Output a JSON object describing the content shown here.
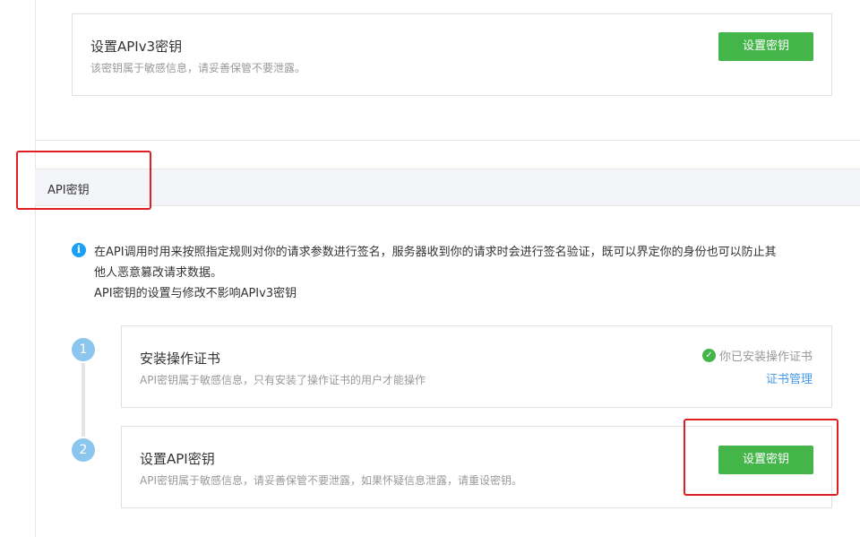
{
  "top_card": {
    "title": "设置APIv3密钥",
    "desc": "该密钥属于敏感信息，请妥善保管不要泄露。",
    "button_label": "设置密钥"
  },
  "section": {
    "header": "API密钥"
  },
  "info": {
    "icon": "info-icon",
    "icon_glyph": "i",
    "line1": "在API调用时用来按照指定规则对你的请求参数进行签名，服务器收到你的请求时会进行签名验证，既可以界定你的身份也可以防止其",
    "line2": "他人恶意篡改请求数据。",
    "line3": "API密钥的设置与修改不影响APIv3密钥"
  },
  "steps": [
    {
      "number": "1",
      "title": "安装操作证书",
      "desc": "API密钥属于敏感信息，只有安装了操作证书的用户才能操作",
      "status_text": "你已安装操作证书",
      "status_icon": "check-circle-icon",
      "status_glyph": "✓",
      "link_label": "证书管理"
    },
    {
      "number": "2",
      "title": "设置API密钥",
      "desc": "API密钥属于敏感信息，请妥善保管不要泄露，如果怀疑信息泄露，请重设密钥。",
      "button_label": "设置密钥"
    }
  ],
  "colors": {
    "primary_green": "#44b549",
    "link_blue": "#459ae9",
    "highlight_red": "#e02020",
    "step_blue": "#8cc6ee"
  }
}
